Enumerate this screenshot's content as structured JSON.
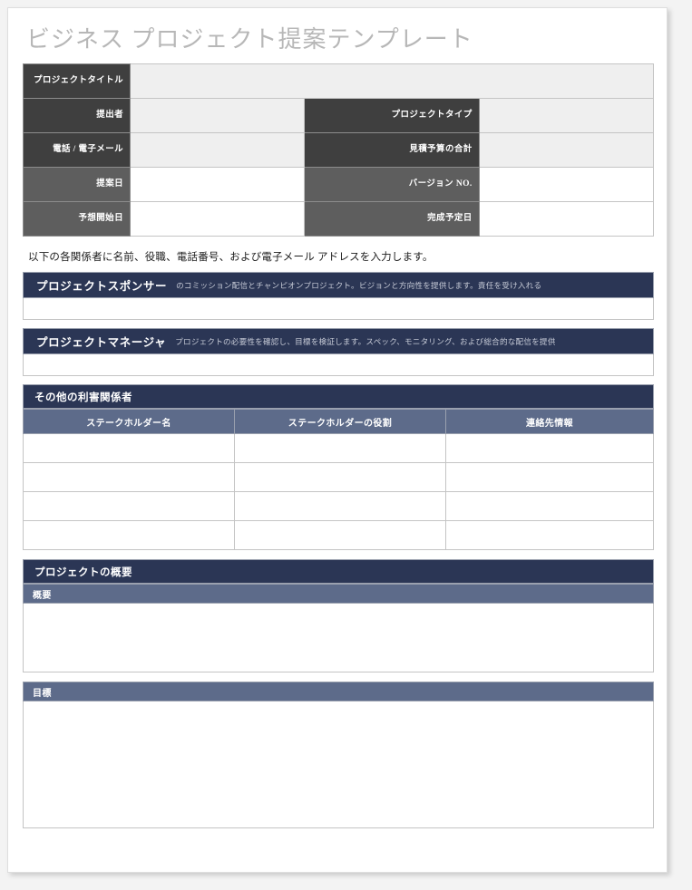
{
  "document": {
    "title": "ビジネス プロジェクト提案テンプレート"
  },
  "info_table": {
    "rows": [
      {
        "left_label": "プロジェクトタイトル",
        "left_value": "",
        "right_label": "",
        "right_value": "",
        "full_width": true
      },
      {
        "left_label": "提出者",
        "left_value": "",
        "right_label": "プロジェクトタイプ",
        "right_value": ""
      },
      {
        "left_label": "電話 / 電子メール",
        "left_value": "",
        "right_label": "見積予算の合計",
        "right_value": ""
      },
      {
        "left_label": "提案日",
        "left_value": "",
        "right_label": "バージョン NO.",
        "right_value": ""
      },
      {
        "left_label": "予想開始日",
        "left_value": "",
        "right_label": "完成予定日",
        "right_value": ""
      }
    ]
  },
  "instruction": "以下の各関係者に名前、役職、電話番号、および電子メール アドレスを入力します。",
  "roles": [
    {
      "title": "プロジェクトスポンサー",
      "description": "のコミッション配信とチャンピオンプロジェクト。ビジョンと方向性を提供します。責任を受け入れる",
      "value": ""
    },
    {
      "title": "プロジェクトマネージャ",
      "description": "プロジェクトの必要性を確認し、目標を検証します。スペック、モニタリング、および総合的な配信を提供",
      "value": ""
    }
  ],
  "stakeholders": {
    "section_title": "その他の利害関係者",
    "columns": [
      "ステークホルダー名",
      "ステークホルダーの役割",
      "連絡先情報"
    ],
    "rows": [
      [
        "",
        "",
        ""
      ],
      [
        "",
        "",
        ""
      ],
      [
        "",
        "",
        ""
      ],
      [
        "",
        "",
        ""
      ]
    ]
  },
  "overview": {
    "section_title": "プロジェクトの概要",
    "summary_label": "概要",
    "summary_value": "",
    "goal_label": "目標",
    "goal_value": ""
  },
  "colors": {
    "navy": "#2b3655",
    "slate": "#5d6b8a",
    "dark_label": "#3f3f3f",
    "mid_label": "#5e5e5e",
    "value_gray": "#efefef",
    "title_gray": "#b7b7b7",
    "border": "#c4c4c4"
  }
}
